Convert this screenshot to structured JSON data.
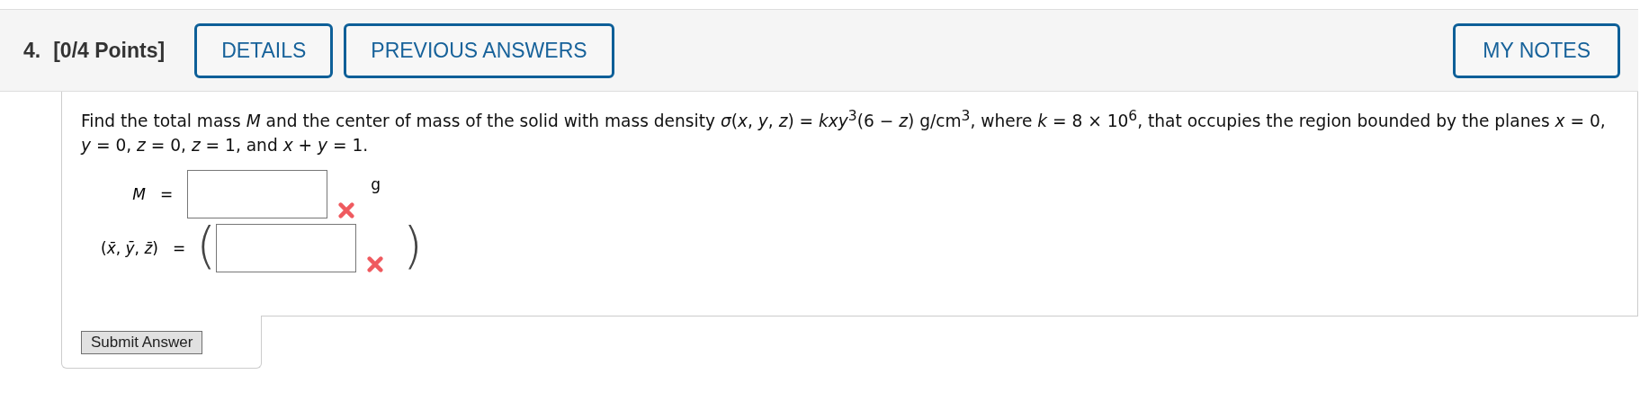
{
  "header": {
    "number": "4.",
    "points": "[0/4 Points]",
    "buttons": [
      "DETAILS",
      "PREVIOUS ANSWERS"
    ],
    "notes_button": "MY NOTES"
  },
  "question": "Find the total mass *M* and the center of mass of the solid with mass density *σ*(*x*, *y*, *z*) = *kxy*$^{3}$(6 − *z*) g/cm$^{3}$, where *k* = 8 × 10$^{6}$, that occupies the region bounded by the planes *x* = 0, *y* = 0, *z* = 0, *z* = 1, and *x* + *y* = 1.",
  "answers": [
    {
      "kind": "plain",
      "label": "*M*",
      "equals": "=",
      "incorrect": true,
      "unit": "g"
    },
    {
      "kind": "paren",
      "label": "(*x̄*, *ȳ*, *z̄*)",
      "equals": "=",
      "open": "(",
      "close": ")",
      "incorrect": true
    }
  ],
  "submit": "Submit Answer"
}
